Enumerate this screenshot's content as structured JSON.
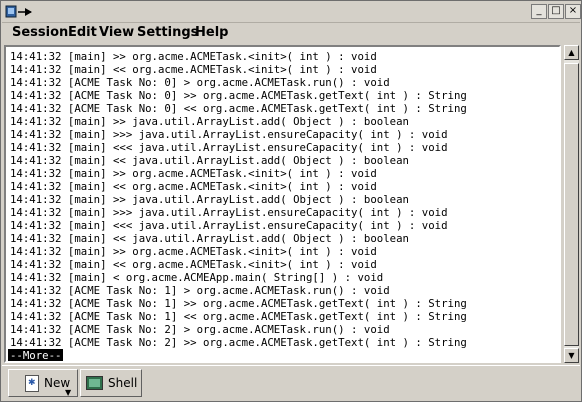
{
  "titlebar": {
    "minimize_glyph": "_",
    "maximize_glyph": "□",
    "close_glyph": "×"
  },
  "menu": [
    "Session",
    "Edit",
    "View",
    "Settings",
    "Help"
  ],
  "terminal": {
    "lines": [
      "14:41:32 [main] >> org.acme.ACMETask.<init>( int ) : void",
      "14:41:32 [main] << org.acme.ACMETask.<init>( int ) : void",
      "14:41:32 [ACME Task No: 0] > org.acme.ACMETask.run() : void",
      "14:41:32 [ACME Task No: 0] >> org.acme.ACMETask.getText( int ) : String",
      "14:41:32 [ACME Task No: 0] << org.acme.ACMETask.getText( int ) : String",
      "14:41:32 [main] >> java.util.ArrayList.add( Object ) : boolean",
      "14:41:32 [main] >>> java.util.ArrayList.ensureCapacity( int ) : void",
      "14:41:32 [main] <<< java.util.ArrayList.ensureCapacity( int ) : void",
      "14:41:32 [main] << java.util.ArrayList.add( Object ) : boolean",
      "14:41:32 [main] >> org.acme.ACMETask.<init>( int ) : void",
      "14:41:32 [main] << org.acme.ACMETask.<init>( int ) : void",
      "14:41:32 [main] >> java.util.ArrayList.add( Object ) : boolean",
      "14:41:32 [main] >>> java.util.ArrayList.ensureCapacity( int ) : void",
      "14:41:32 [main] <<< java.util.ArrayList.ensureCapacity( int ) : void",
      "14:41:32 [main] << java.util.ArrayList.add( Object ) : boolean",
      "14:41:32 [main] >> org.acme.ACMETask.<init>( int ) : void",
      "14:41:32 [main] << org.acme.ACMETask.<init>( int ) : void",
      "14:41:32 [main] < org.acme.ACMEApp.main( String[] ) : void",
      "14:41:32 [ACME Task No: 1] > org.acme.ACMETask.run() : void",
      "14:41:32 [ACME Task No: 1] >> org.acme.ACMETask.getText( int ) : String",
      "14:41:32 [ACME Task No: 1] << org.acme.ACMETask.getText( int ) : String",
      "14:41:32 [ACME Task No: 2] > org.acme.ACMETask.run() : void",
      "14:41:32 [ACME Task No: 2] >> org.acme.ACMETask.getText( int ) : String"
    ],
    "pager_prompt": "--More--"
  },
  "tabs": {
    "new_label": "New",
    "shell_label": "Shell"
  },
  "colors": {
    "chrome": "#d4d0c8",
    "terminal_bg": "#ffffff",
    "terminal_fg": "#000000"
  }
}
